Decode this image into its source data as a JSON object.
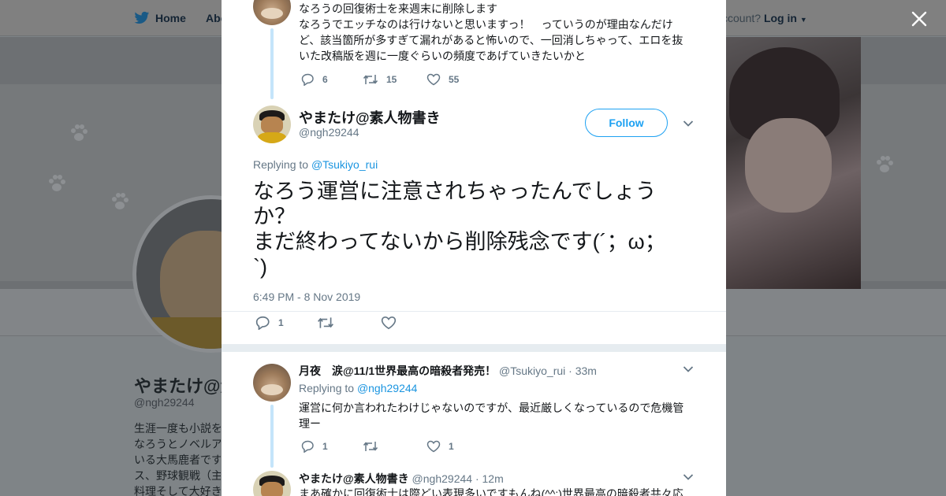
{
  "background": {
    "nav": {
      "home": "Home",
      "about": "Abo",
      "login_prefix": "ccount?",
      "login": "Log in"
    },
    "profile_name": "やまたけ@素",
    "profile_handle": "@ngh29244",
    "bio_lines": [
      "生涯一度も小説を",
      "なろうとノベルア",
      "いる大馬鹿者です",
      "ス、野球観戦（主",
      "料理そして大好き"
    ]
  },
  "close_label": "×",
  "prev_tweet": {
    "text_lines": [
      "なろうの回復術士を来週末に削除します",
      "なろうでエッチなのは行けないと思いますっ！　っていうのが理由なんだけ",
      "ど、該当箇所が多すぎて漏れがあると怖いので、一回消しちゃって、エロを抜",
      "いた改稿版を週に一度ぐらいの頻度であげていきたいかと"
    ],
    "replies": "6",
    "retweets": "15",
    "likes": "55"
  },
  "main_tweet": {
    "name": "やまたけ@素人物書き",
    "handle": "@ngh29244",
    "follow_label": "Follow",
    "replying_prefix": "Replying to",
    "replying_to": "@Tsukiyo_rui",
    "text": "なろう運営に注意されちゃったんでしょう\nか？\nまだ終わってないから削除残念です(´；ω；\n`)",
    "timestamp": "6:49 PM - 8 Nov 2019",
    "replies": "1",
    "retweets": "",
    "likes": ""
  },
  "reply1": {
    "name": "月夜　涙@11/1世界最高の暗殺者発売！",
    "handle": "@Tsukiyo_rui",
    "time": "· 33m",
    "replying_prefix": "Replying to",
    "replying_to": "@ngh29244",
    "text_lines": [
      "運営に何か言われたわけじゃないのですが、最近厳しくなっているので危機管",
      "理ー"
    ],
    "replies": "1",
    "retweets": "",
    "likes": "1"
  },
  "reply2": {
    "name": "やまたけ@素人物書き",
    "handle": "@ngh29244",
    "time": "· 12m",
    "text_line": "まあ確かに回復術士は際どい表現多いですもんね(^^;)世界最高の暗殺者共々応"
  }
}
